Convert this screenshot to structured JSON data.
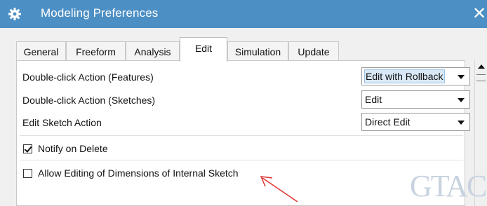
{
  "window": {
    "title": "Modeling Preferences",
    "close_glyph": "✕"
  },
  "tabs": [
    {
      "label": "General",
      "active": false
    },
    {
      "label": "Freeform",
      "active": false
    },
    {
      "label": "Analysis",
      "active": false
    },
    {
      "label": "Edit",
      "active": true
    },
    {
      "label": "Simulation",
      "active": false
    },
    {
      "label": "Update",
      "active": false
    }
  ],
  "settings": {
    "double_click_features": {
      "label": "Double-click Action (Features)",
      "value": "Edit with Rollback"
    },
    "double_click_sketches": {
      "label": "Double-click Action (Sketches)",
      "value": "Edit"
    },
    "edit_sketch_action": {
      "label": "Edit Sketch Action",
      "value": "Direct Edit"
    },
    "notify_on_delete": {
      "label": "Notify on Delete",
      "checked": true
    },
    "allow_editing_dimensions": {
      "label": "Allow Editing of Dimensions of Internal Sketch",
      "checked": false
    }
  },
  "icons": {
    "title_icon": "gear-icon",
    "close": "close-icon",
    "dropdown": "chevron-down-icon",
    "scroll_up": "scroll-up-arrow-icon"
  },
  "annotation": {
    "color": "#e0302f"
  },
  "watermark": {
    "text": "GTAC"
  },
  "colors": {
    "titlebar": "#4c8fc4",
    "selected_highlight": "#d8e8f6"
  }
}
